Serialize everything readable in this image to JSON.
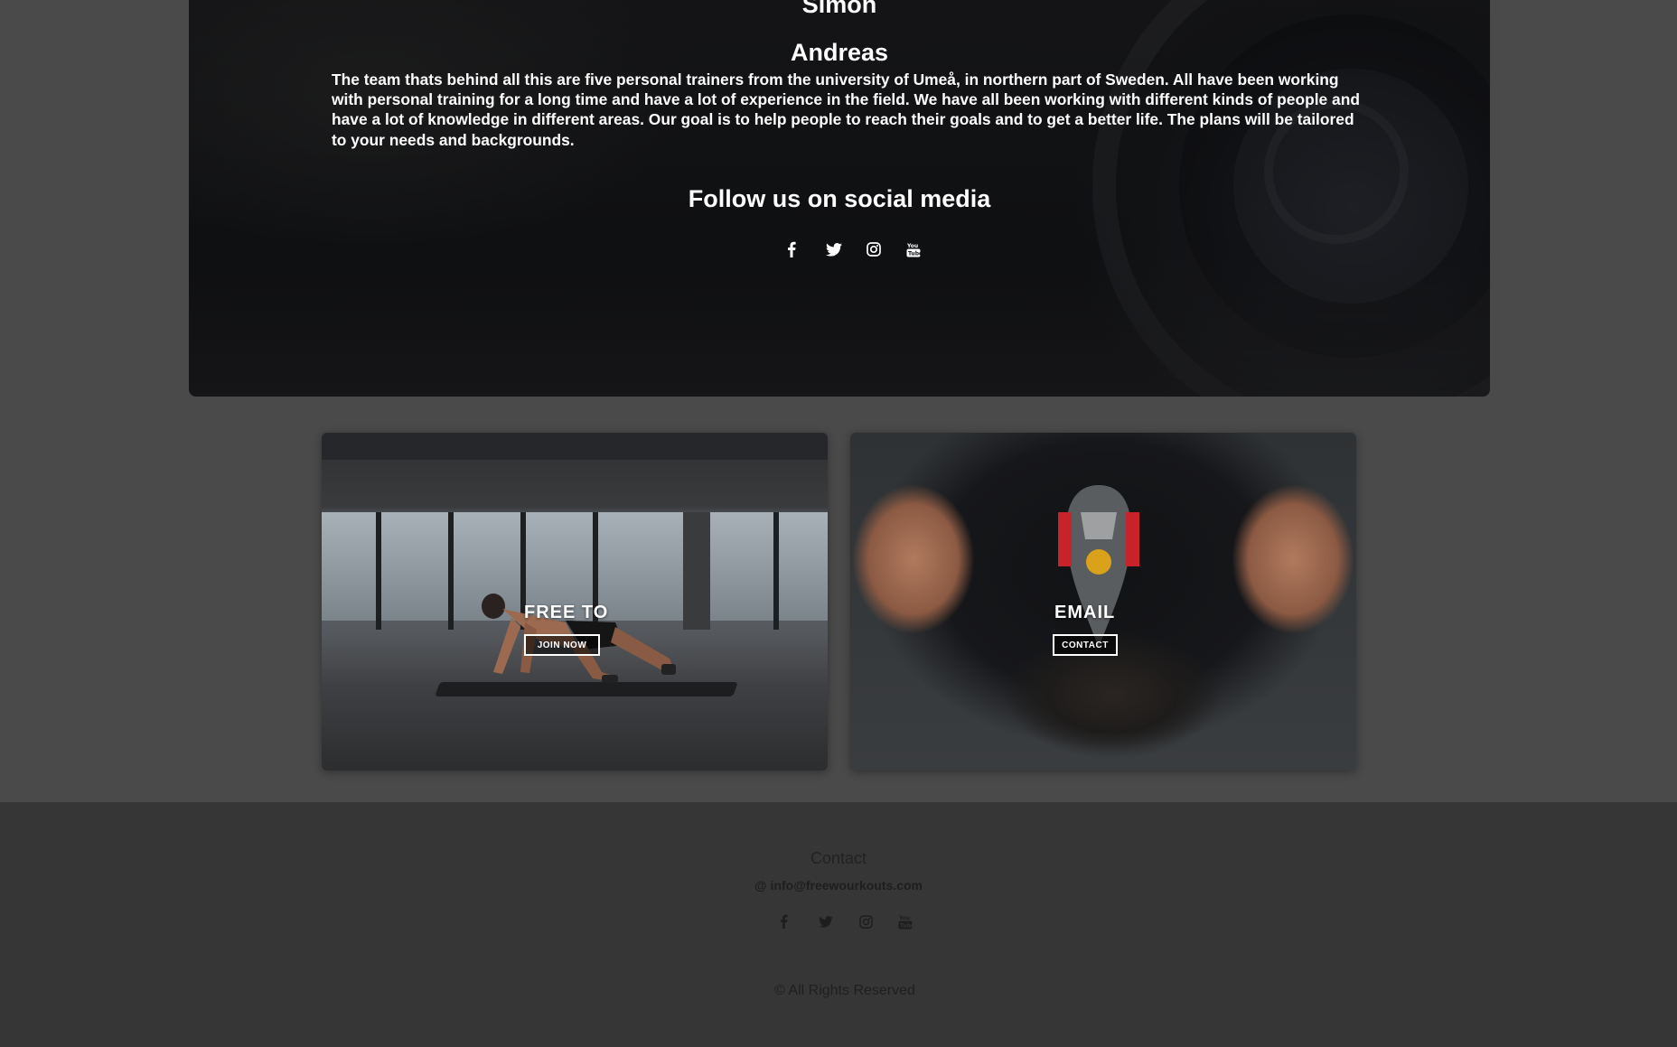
{
  "about": {
    "names": [
      "Simon",
      "Andreas"
    ],
    "text": "The team thats behind all this are five personal trainers from the university of Umeå, in northern part of Sweden. All have been working with personal training for a long time and have a lot of experience in the field. We have all been working with different kinds of people and have a lot of knowledge in different areas. Our goal is to help people to reach their goals and to get a better life. The plans will be tailored to your needs and backgrounds.",
    "follow_heading": "Follow us on social media",
    "social_icons": [
      "facebook-icon",
      "twitter-icon",
      "instagram-icon",
      "youtube-icon"
    ]
  },
  "cards": [
    {
      "title": "FREE TO",
      "button": "JOIN NOW",
      "image": "man doing mountain climber exercise in gym"
    },
    {
      "title": "EMAIL",
      "button": "CONTACT",
      "image": "top view of man doing push-ups"
    }
  ],
  "footer": {
    "contact_title": "Contact",
    "email": "@ info@freewourkouts.com",
    "social_icons": [
      "facebook-icon",
      "twitter-icon",
      "instagram-icon",
      "youtube-icon"
    ],
    "copyright": "© All Rights Reserved"
  },
  "colors": {
    "page_bg": "#4a4a4a",
    "footer_bg": "#363636",
    "about_bg": "#0f1012",
    "text_light": "#ffffff",
    "text_dark": "#222222"
  }
}
